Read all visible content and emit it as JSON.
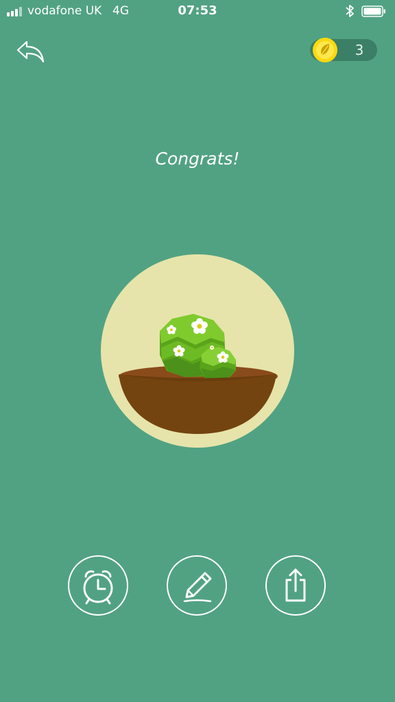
{
  "status_bar": {
    "carrier": "vodafone UK",
    "network": "4G",
    "time": "07:53",
    "signal_bars": 4,
    "icons": [
      "signal-bars-icon",
      "bluetooth-icon",
      "battery-icon"
    ]
  },
  "header": {
    "back_icon": "back-arrow-icon",
    "coins": {
      "icon": "seed-coin-icon",
      "count": "3"
    }
  },
  "main": {
    "message": "Congrats!",
    "illustration": "bush-with-flowers-in-bowl"
  },
  "actions": [
    {
      "name": "timer-button",
      "icon": "alarm-clock-icon"
    },
    {
      "name": "note-button",
      "icon": "pencil-icon"
    },
    {
      "name": "share-button",
      "icon": "share-icon"
    }
  ],
  "colors": {
    "background": "#51a283",
    "coin_pill": "#3b7f66",
    "coin": "#ffd90f",
    "circle": "#e6e4aa",
    "bowl_top": "#8a4b1b",
    "bowl_body": "#73440f",
    "bush": "#6cbd22",
    "flower": "#ffffff"
  }
}
